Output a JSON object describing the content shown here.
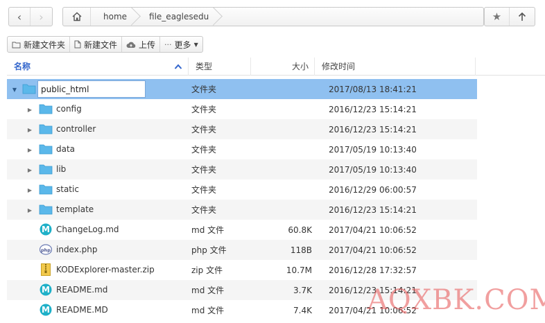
{
  "address_bar": {
    "breadcrumbs": [
      "home",
      "file_eaglesedu"
    ]
  },
  "toolbar": {
    "new_folder": "新建文件夹",
    "new_file": "新建文件",
    "upload": "上传",
    "more": "更多"
  },
  "columns": {
    "name": "名称",
    "type": "类型",
    "size": "大小",
    "mtime": "修改时间"
  },
  "rows": [
    {
      "name": "public_html",
      "type": "文件夹",
      "size": "",
      "mtime": "2017/08/13 18:41:21",
      "icon": "folder-icon",
      "expand": "open"
    },
    {
      "name": "config",
      "type": "文件夹",
      "size": "",
      "mtime": "2016/12/23 15:14:21",
      "icon": "folder-icon",
      "expand": "closed"
    },
    {
      "name": "controller",
      "type": "文件夹",
      "size": "",
      "mtime": "2016/12/23 15:14:21",
      "icon": "folder-icon",
      "expand": "closed"
    },
    {
      "name": "data",
      "type": "文件夹",
      "size": "",
      "mtime": "2017/05/19 10:13:40",
      "icon": "folder-icon",
      "expand": "closed"
    },
    {
      "name": "lib",
      "type": "文件夹",
      "size": "",
      "mtime": "2017/05/19 10:13:40",
      "icon": "folder-icon",
      "expand": "closed"
    },
    {
      "name": "static",
      "type": "文件夹",
      "size": "",
      "mtime": "2016/12/29 06:00:57",
      "icon": "folder-icon",
      "expand": "closed"
    },
    {
      "name": "template",
      "type": "文件夹",
      "size": "",
      "mtime": "2016/12/23 15:14:21",
      "icon": "folder-icon",
      "expand": "closed"
    },
    {
      "name": "ChangeLog.md",
      "type": "md 文件",
      "size": "60.8K",
      "mtime": "2017/04/21 10:06:52",
      "icon": "markdown-icon",
      "expand": "none"
    },
    {
      "name": "index.php",
      "type": "php 文件",
      "size": "118B",
      "mtime": "2017/04/21 10:06:52",
      "icon": "php-icon",
      "expand": "none"
    },
    {
      "name": "KODExplorer-master.zip",
      "type": "zip 文件",
      "size": "10.7M",
      "mtime": "2016/12/28 17:32:57",
      "icon": "zip-icon",
      "expand": "none"
    },
    {
      "name": "README.md",
      "type": "md 文件",
      "size": "3.7K",
      "mtime": "2016/12/23 15:14:21",
      "icon": "markdown-icon",
      "expand": "none"
    },
    {
      "name": "README.MD",
      "type": "md 文件",
      "size": "7.4K",
      "mtime": "2017/04/21 10:06:52",
      "icon": "markdown-icon",
      "expand": "none"
    }
  ],
  "watermark": "AQXBK.COM",
  "colors": {
    "selected_row": "#8fc0f0",
    "folder": "#5bb8ea",
    "markdown": "#1fb0c8",
    "header_name": "#3366cc"
  }
}
